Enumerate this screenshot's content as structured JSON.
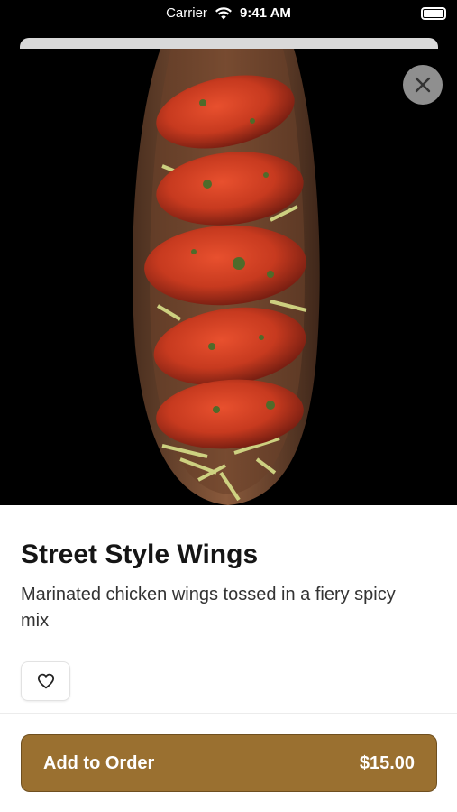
{
  "status_bar": {
    "carrier": "Carrier",
    "time": "9:41 AM"
  },
  "item": {
    "name": "Street Style Wings",
    "description": "Marinated chicken wings tossed in a fiery spicy mix",
    "image_icon": "food-photo"
  },
  "actions": {
    "close_icon": "close-icon",
    "favorite_icon": "heart-icon",
    "add_label": "Add to Order",
    "price": "$15.00"
  },
  "colors": {
    "accent": "#9a7030",
    "close_bg": "#8f8f8f"
  }
}
